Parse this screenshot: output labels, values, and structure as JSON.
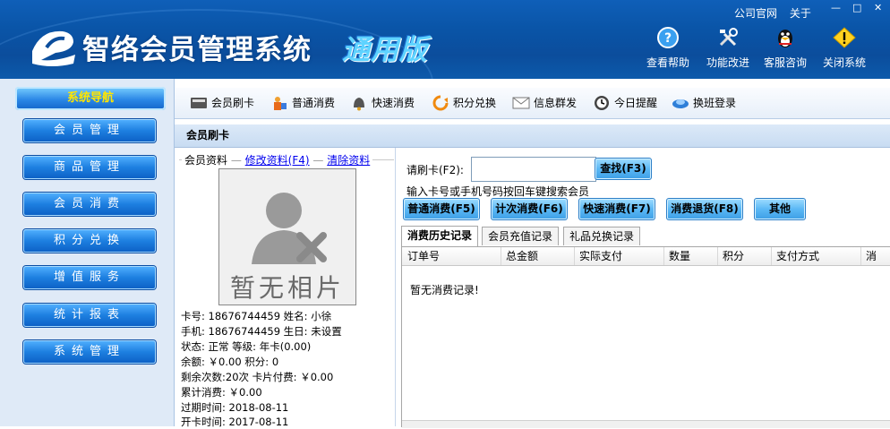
{
  "header": {
    "title": "智络会员管理系统",
    "edition": "通用版",
    "top_links": [
      "公司官网",
      "关于"
    ],
    "window_controls": [
      "—",
      "□",
      "✕"
    ],
    "actions": [
      {
        "label": "查看帮助",
        "icon": "help-icon"
      },
      {
        "label": "功能改进",
        "icon": "tools-icon"
      },
      {
        "label": "客服咨询",
        "icon": "qq-penguin-icon"
      },
      {
        "label": "关闭系统",
        "icon": "warning-icon"
      }
    ]
  },
  "nav": {
    "title": "系统导航",
    "items": [
      "会员管理",
      "商品管理",
      "会员消费",
      "积分兑换",
      "增值服务",
      "统计报表",
      "系统管理"
    ]
  },
  "toolbar": {
    "items": [
      {
        "label": "会员刷卡",
        "icon": "card-reader-icon"
      },
      {
        "label": "普通消费",
        "icon": "shopper-icon"
      },
      {
        "label": "快速消费",
        "icon": "bell-icon"
      },
      {
        "label": "积分兑换",
        "icon": "refresh-icon"
      },
      {
        "label": "信息群发",
        "icon": "envelope-icon"
      },
      {
        "label": "今日提醒",
        "icon": "clock-icon"
      },
      {
        "label": "换班登录",
        "icon": "shift-icon"
      }
    ]
  },
  "card_panel": {
    "title": "会员刷卡",
    "legend": "会员资料",
    "edit_link": "修改资料(F4)",
    "clear_link": "清除资料",
    "photo_placeholder": "暂无相片",
    "info_lines": [
      "卡号: 18676744459  姓名: 小徐",
      "手机: 18676744459  生日: 未设置",
      "状态: 正常         等级: 年卡(0.00)",
      "余额: ￥0.00       积分: 0",
      "剩余次数:20次      卡片付费: ￥0.00",
      "累计消费: ￥0.00",
      "过期时间: 2018-08-11",
      "开卡时间: 2017-08-11"
    ]
  },
  "swipe": {
    "label": "请刷卡(F2):",
    "input_value": "",
    "search_button": "查找(F3)",
    "hint": "输入卡号或手机号码按回车键搜索会员",
    "action_buttons": [
      "普通消费(F5)",
      "计次消费(F6)",
      "快速消费(F7)",
      "消费退货(F8)",
      "其他"
    ]
  },
  "tabs": [
    "消费历史记录",
    "会员充值记录",
    "礼品兑换记录"
  ],
  "history_table": {
    "columns": [
      "订单号",
      "总金额",
      "实际支付",
      "数量",
      "积分",
      "支付方式",
      "消"
    ],
    "empty_text": "暂无消费记录!"
  },
  "colors": {
    "header_blue": "#0b4d9c",
    "nav_button": "#1d7fe0",
    "nav_title_text": "#ffe600",
    "action_button": "#5bb8f5"
  }
}
